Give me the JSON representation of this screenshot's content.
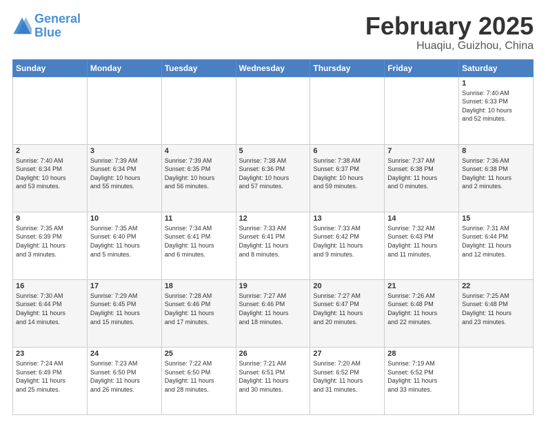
{
  "logo": {
    "line1": "General",
    "line2": "Blue"
  },
  "title": "February 2025",
  "location": "Huaqiu, Guizhou, China",
  "days_of_week": [
    "Sunday",
    "Monday",
    "Tuesday",
    "Wednesday",
    "Thursday",
    "Friday",
    "Saturday"
  ],
  "weeks": [
    [
      {
        "num": "",
        "info": ""
      },
      {
        "num": "",
        "info": ""
      },
      {
        "num": "",
        "info": ""
      },
      {
        "num": "",
        "info": ""
      },
      {
        "num": "",
        "info": ""
      },
      {
        "num": "",
        "info": ""
      },
      {
        "num": "1",
        "info": "Sunrise: 7:40 AM\nSunset: 6:33 PM\nDaylight: 10 hours\nand 52 minutes."
      }
    ],
    [
      {
        "num": "2",
        "info": "Sunrise: 7:40 AM\nSunset: 6:34 PM\nDaylight: 10 hours\nand 53 minutes."
      },
      {
        "num": "3",
        "info": "Sunrise: 7:39 AM\nSunset: 6:34 PM\nDaylight: 10 hours\nand 55 minutes."
      },
      {
        "num": "4",
        "info": "Sunrise: 7:39 AM\nSunset: 6:35 PM\nDaylight: 10 hours\nand 56 minutes."
      },
      {
        "num": "5",
        "info": "Sunrise: 7:38 AM\nSunset: 6:36 PM\nDaylight: 10 hours\nand 57 minutes."
      },
      {
        "num": "6",
        "info": "Sunrise: 7:38 AM\nSunset: 6:37 PM\nDaylight: 10 hours\nand 59 minutes."
      },
      {
        "num": "7",
        "info": "Sunrise: 7:37 AM\nSunset: 6:38 PM\nDaylight: 11 hours\nand 0 minutes."
      },
      {
        "num": "8",
        "info": "Sunrise: 7:36 AM\nSunset: 6:38 PM\nDaylight: 11 hours\nand 2 minutes."
      }
    ],
    [
      {
        "num": "9",
        "info": "Sunrise: 7:35 AM\nSunset: 6:39 PM\nDaylight: 11 hours\nand 3 minutes."
      },
      {
        "num": "10",
        "info": "Sunrise: 7:35 AM\nSunset: 6:40 PM\nDaylight: 11 hours\nand 5 minutes."
      },
      {
        "num": "11",
        "info": "Sunrise: 7:34 AM\nSunset: 6:41 PM\nDaylight: 11 hours\nand 6 minutes."
      },
      {
        "num": "12",
        "info": "Sunrise: 7:33 AM\nSunset: 6:41 PM\nDaylight: 11 hours\nand 8 minutes."
      },
      {
        "num": "13",
        "info": "Sunrise: 7:33 AM\nSunset: 6:42 PM\nDaylight: 11 hours\nand 9 minutes."
      },
      {
        "num": "14",
        "info": "Sunrise: 7:32 AM\nSunset: 6:43 PM\nDaylight: 11 hours\nand 11 minutes."
      },
      {
        "num": "15",
        "info": "Sunrise: 7:31 AM\nSunset: 6:44 PM\nDaylight: 11 hours\nand 12 minutes."
      }
    ],
    [
      {
        "num": "16",
        "info": "Sunrise: 7:30 AM\nSunset: 6:44 PM\nDaylight: 11 hours\nand 14 minutes."
      },
      {
        "num": "17",
        "info": "Sunrise: 7:29 AM\nSunset: 6:45 PM\nDaylight: 11 hours\nand 15 minutes."
      },
      {
        "num": "18",
        "info": "Sunrise: 7:28 AM\nSunset: 6:46 PM\nDaylight: 11 hours\nand 17 minutes."
      },
      {
        "num": "19",
        "info": "Sunrise: 7:27 AM\nSunset: 6:46 PM\nDaylight: 11 hours\nand 18 minutes."
      },
      {
        "num": "20",
        "info": "Sunrise: 7:27 AM\nSunset: 6:47 PM\nDaylight: 11 hours\nand 20 minutes."
      },
      {
        "num": "21",
        "info": "Sunrise: 7:26 AM\nSunset: 6:48 PM\nDaylight: 11 hours\nand 22 minutes."
      },
      {
        "num": "22",
        "info": "Sunrise: 7:25 AM\nSunset: 6:48 PM\nDaylight: 11 hours\nand 23 minutes."
      }
    ],
    [
      {
        "num": "23",
        "info": "Sunrise: 7:24 AM\nSunset: 6:49 PM\nDaylight: 11 hours\nand 25 minutes."
      },
      {
        "num": "24",
        "info": "Sunrise: 7:23 AM\nSunset: 6:50 PM\nDaylight: 11 hours\nand 26 minutes."
      },
      {
        "num": "25",
        "info": "Sunrise: 7:22 AM\nSunset: 6:50 PM\nDaylight: 11 hours\nand 28 minutes."
      },
      {
        "num": "26",
        "info": "Sunrise: 7:21 AM\nSunset: 6:51 PM\nDaylight: 11 hours\nand 30 minutes."
      },
      {
        "num": "27",
        "info": "Sunrise: 7:20 AM\nSunset: 6:52 PM\nDaylight: 11 hours\nand 31 minutes."
      },
      {
        "num": "28",
        "info": "Sunrise: 7:19 AM\nSunset: 6:52 PM\nDaylight: 11 hours\nand 33 minutes."
      },
      {
        "num": "",
        "info": ""
      }
    ]
  ]
}
